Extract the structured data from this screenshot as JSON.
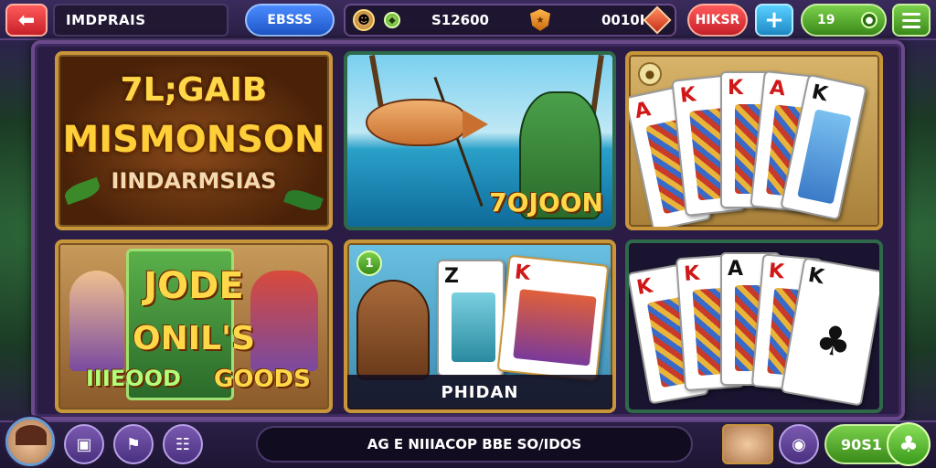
{
  "header": {
    "back_icon": "arrow-left-icon",
    "title": "IMDPRAIS",
    "blue_pill_label": "EBSSS",
    "resources": {
      "coins_value": "S12600",
      "gems_value": "0010I"
    },
    "red_pill_label": "HIKSR",
    "add_icon": "plus-icon",
    "green_pill_value": "19",
    "menu_icon": "hamburger-menu-icon"
  },
  "tiles": [
    {
      "line1": "7L;GAIB",
      "line2": "MISMONSON",
      "line3": "IINDARMSIAS"
    },
    {
      "amount": "7OJOON"
    },
    {
      "badge": "",
      "cards": [
        "A",
        "K",
        "K",
        "A",
        "K"
      ]
    },
    {
      "line1": "JODE",
      "line2": "ONIL'S",
      "line3": "IIIEOOD",
      "line4": "GOODS"
    },
    {
      "badge": "1",
      "label": "PHIDAN"
    },
    {
      "cards": [
        "K",
        "K",
        "A",
        "K",
        "K"
      ]
    }
  ],
  "footer": {
    "news_text": "AG E NIIIACOP BBE SO/IDOS",
    "play_value": "90S1",
    "play_icon": "clover-icon"
  },
  "colors": {
    "accent_green": "#7ad04a",
    "accent_red": "#e0303a",
    "accent_blue": "#2e6ee0",
    "gold": "#ffd84a",
    "panel_purple": "#2a1c44"
  }
}
